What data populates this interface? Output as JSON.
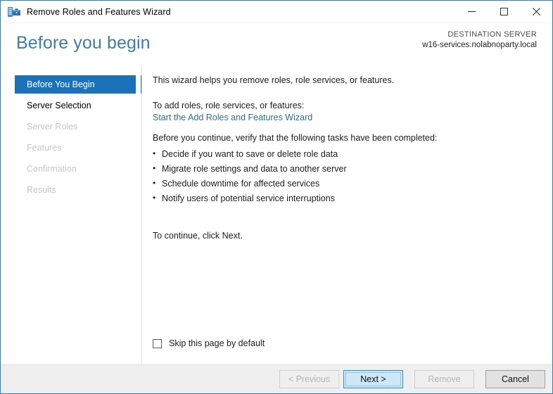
{
  "window": {
    "title": "Remove Roles and Features Wizard",
    "icon": "server-roles-icon",
    "controls": {
      "minimize": "minimize-icon",
      "maximize": "maximize-icon",
      "close": "close-icon"
    }
  },
  "header": {
    "title": "Before you begin",
    "destination_label": "DESTINATION SERVER",
    "destination_server": "w16-services.nolabnoparty.local"
  },
  "sidebar": {
    "items": [
      {
        "label": "Before You Begin",
        "state": "selected"
      },
      {
        "label": "Server Selection",
        "state": "enabled"
      },
      {
        "label": "Server Roles",
        "state": "disabled"
      },
      {
        "label": "Features",
        "state": "disabled"
      },
      {
        "label": "Confirmation",
        "state": "disabled"
      },
      {
        "label": "Results",
        "state": "disabled"
      }
    ]
  },
  "content": {
    "intro": "This wizard helps you remove roles, role services, or features.",
    "add_prompt": "To add roles, role services, or features:",
    "add_link": "Start the Add Roles and Features Wizard",
    "verify_prompt": "Before you continue, verify that the following tasks have been completed:",
    "tasks": [
      "Decide if you want to save or delete role data",
      "Migrate role settings and data to another server",
      "Schedule downtime for affected services",
      "Notify users of potential service interruptions"
    ],
    "continue_text": "To continue, click Next.",
    "skip_checkbox": {
      "label": "Skip this page by default",
      "checked": false
    }
  },
  "footer": {
    "buttons": [
      {
        "label": "< Previous",
        "state": "disabled"
      },
      {
        "label": "Next >",
        "state": "focused"
      },
      {
        "label": "Remove",
        "state": "disabled"
      },
      {
        "label": "Cancel",
        "state": "normal"
      }
    ]
  },
  "colors": {
    "accent": "#1b72b8",
    "title_text": "#3e7ea3",
    "link": "#2e6f90",
    "window_border": "#2f7fc1",
    "footer_bg": "#efefef",
    "focused_button_bg": "#cde8f8"
  }
}
